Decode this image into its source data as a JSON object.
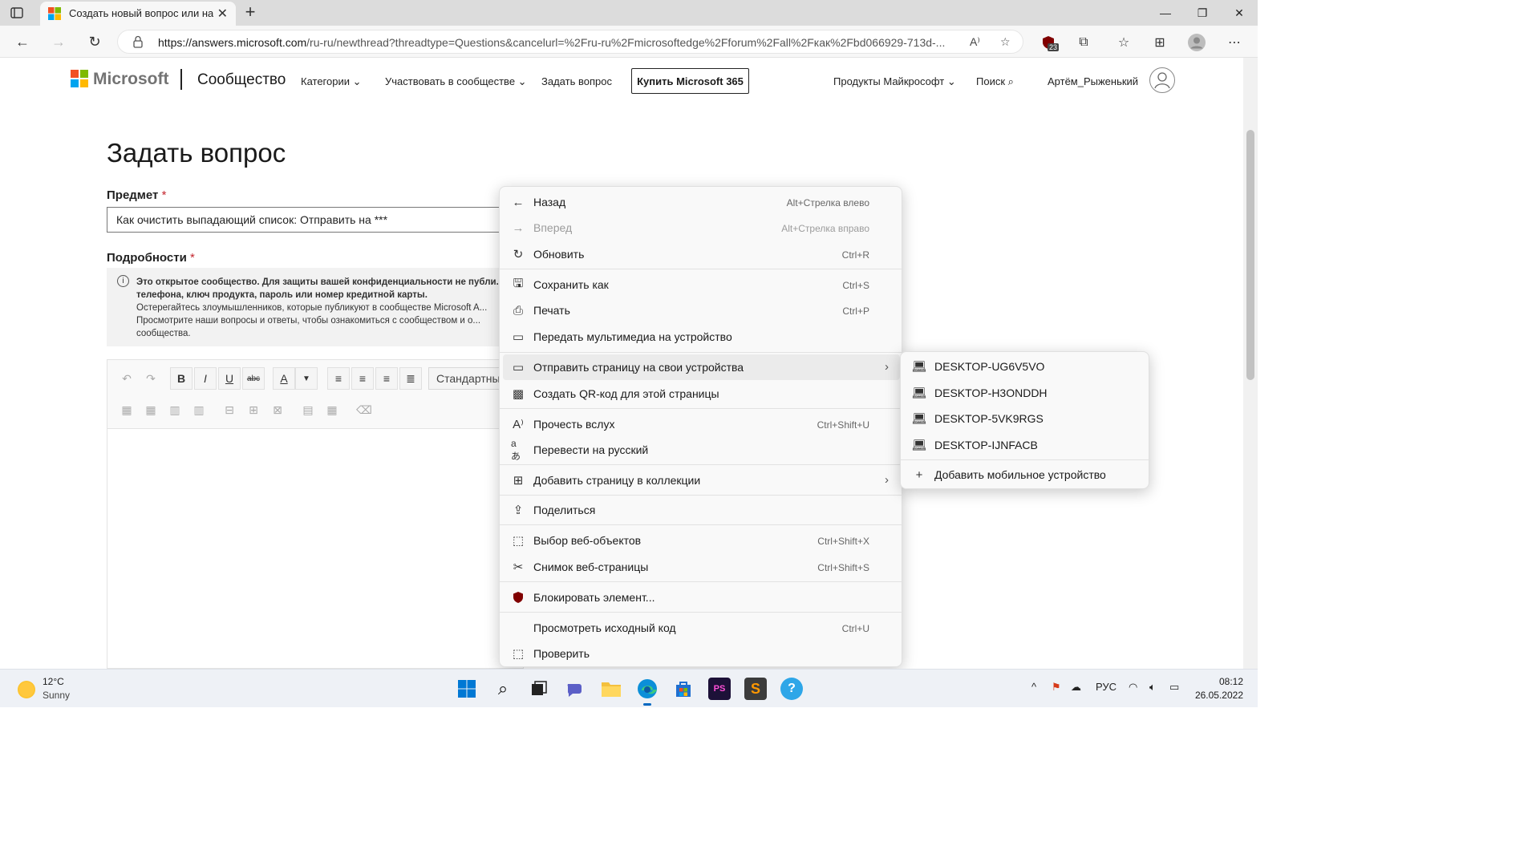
{
  "browser": {
    "tab_title": "Создать новый вопрос или на...",
    "url_host": "https://answers.microsoft.com",
    "url_path": "/ru-ru/newthread?threadtype=Questions&cancelurl=%2Fru-ru%2Fmicrosoftedge%2Fforum%2Fall%2Fкак%2Fbd066929-713d-...",
    "extension_badge": "23"
  },
  "header": {
    "brand": "Microsoft",
    "community": "Сообщество",
    "nav": [
      "Категории",
      "Участвовать в сообществе",
      "Задать вопрос"
    ],
    "buy_button": "Купить Microsoft 365",
    "products": "Продукты Майкрософт",
    "search": "Поиск",
    "user": "Артём_Рыженький"
  },
  "form": {
    "title": "Задать вопрос",
    "subject_label": "Предмет",
    "subject_value": "Как очистить выпадающий список: Отправить на ***",
    "details_label": "Подробности",
    "required_mark": "*",
    "notice_bold": "Это открытое сообщество. Для защиты вашей конфиденциальности не публи... телефона, ключ продукта, пароль или номер кредитной карты.",
    "notice_line2": "Остерегайтесь злоумышленников, которые публикуют в сообществе Microsoft A...",
    "notice_line3": " Просмотрите наши вопросы и ответы, чтобы ознакомиться с сообществом и о... сообщества.",
    "format_select": "Стандартный",
    "font_color_letter": "A"
  },
  "context_menu": {
    "items": [
      {
        "label": "Назад",
        "shortcut": "Alt+Стрелка влево"
      },
      {
        "label": "Вперед",
        "shortcut": "Alt+Стрелка вправо"
      },
      {
        "label": "Обновить",
        "shortcut": "Ctrl+R"
      },
      {
        "label": "Сохранить как",
        "shortcut": "Ctrl+S"
      },
      {
        "label": "Печать",
        "shortcut": "Ctrl+P"
      },
      {
        "label": "Передать мультимедиа на устройство",
        "shortcut": ""
      },
      {
        "label": "Отправить страницу на свои устройства",
        "shortcut": ""
      },
      {
        "label": "Создать QR-код для этой страницы",
        "shortcut": ""
      },
      {
        "label": "Прочесть вслух",
        "shortcut": "Ctrl+Shift+U"
      },
      {
        "label": "Перевести на русский",
        "shortcut": ""
      },
      {
        "label": "Добавить страницу в коллекции",
        "shortcut": ""
      },
      {
        "label": "Поделиться",
        "shortcut": ""
      },
      {
        "label": "Выбор веб-объектов",
        "shortcut": "Ctrl+Shift+X"
      },
      {
        "label": "Снимок веб-страницы",
        "shortcut": "Ctrl+Shift+S"
      },
      {
        "label": "Блокировать элемент...",
        "shortcut": ""
      },
      {
        "label": "Просмотреть исходный код",
        "shortcut": "Ctrl+U"
      },
      {
        "label": "Проверить",
        "shortcut": ""
      }
    ]
  },
  "submenu": {
    "devices": [
      "DESKTOP-UG6V5VO",
      "DESKTOP-H3ONDDH",
      "DESKTOP-5VK9RGS",
      "DESKTOP-IJNFACB"
    ],
    "add_mobile": "Добавить мобильное устройство"
  },
  "taskbar": {
    "temperature": "12°C",
    "condition": "Sunny",
    "language": "РУС",
    "time": "08:12",
    "date": "26.05.2022"
  }
}
